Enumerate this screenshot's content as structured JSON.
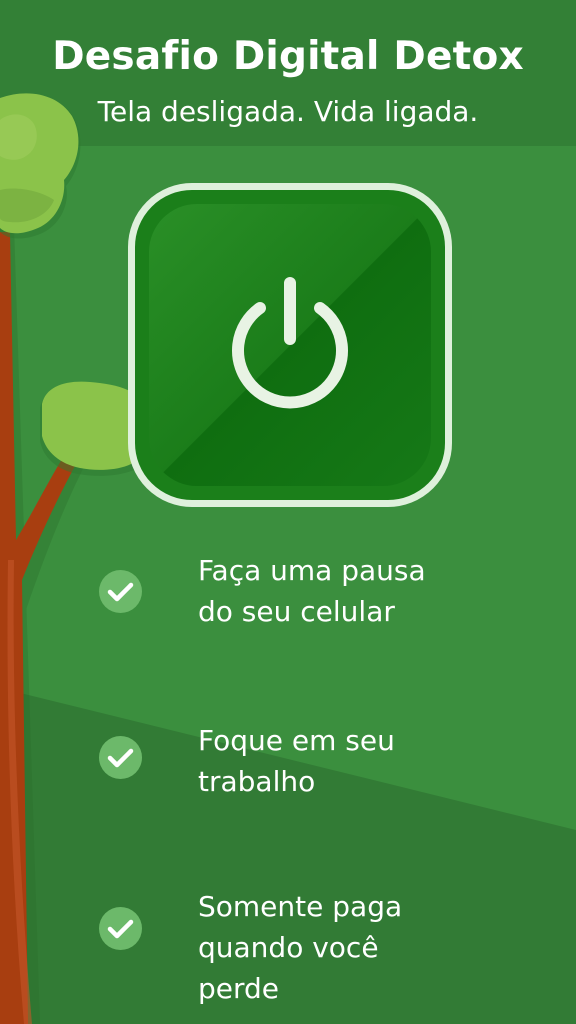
{
  "header": {
    "title": "Desafio Digital Detox",
    "subtitle": "Tela desligada. Vida ligada."
  },
  "colors": {
    "background": "#3b8f3e",
    "background_dark": "#327b35",
    "header": "#338036",
    "button": "#1b7f1a",
    "button_border": "#dff0dc",
    "check": "#6cb96a",
    "trunk": "#a83e10",
    "leaves": "#8bc34a"
  },
  "power_button": {
    "icon": "power-icon"
  },
  "features": [
    {
      "icon": "check-icon",
      "text": "Faça uma pausa\ndo seu celular"
    },
    {
      "icon": "check-icon",
      "text": "Foque em seu\ntrabalho"
    },
    {
      "icon": "check-icon",
      "text": "Somente paga\nquando você\nperde"
    }
  ]
}
